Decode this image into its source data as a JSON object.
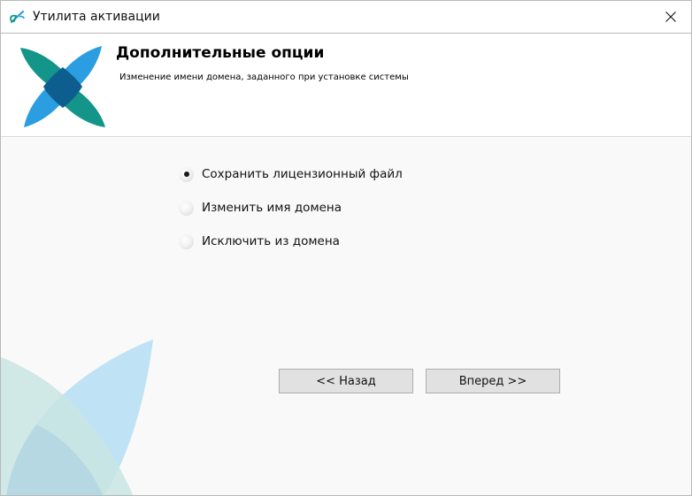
{
  "window": {
    "title": "Утилита активации"
  },
  "header": {
    "title": "Дополнительные опции",
    "subtitle": "Изменение имени домена, заданного при установке системы"
  },
  "options": [
    {
      "label": "Сохранить лицензионный файл",
      "selected": true
    },
    {
      "label": "Изменить имя домена",
      "selected": false
    },
    {
      "label": "Исключить из домена",
      "selected": false
    }
  ],
  "buttons": {
    "back_label": "<< Назад",
    "next_label": "Вперед >>"
  },
  "colors": {
    "logo_teal": "#13958a",
    "logo_blue": "#2a9ee0",
    "logo_dark": "#0d5e8e",
    "button_bg": "#e1e1e1",
    "content_bg": "#f9f9f9"
  },
  "icons": {
    "app": "activation-utility-icon",
    "close": "close-icon",
    "logo": "company-logo"
  }
}
